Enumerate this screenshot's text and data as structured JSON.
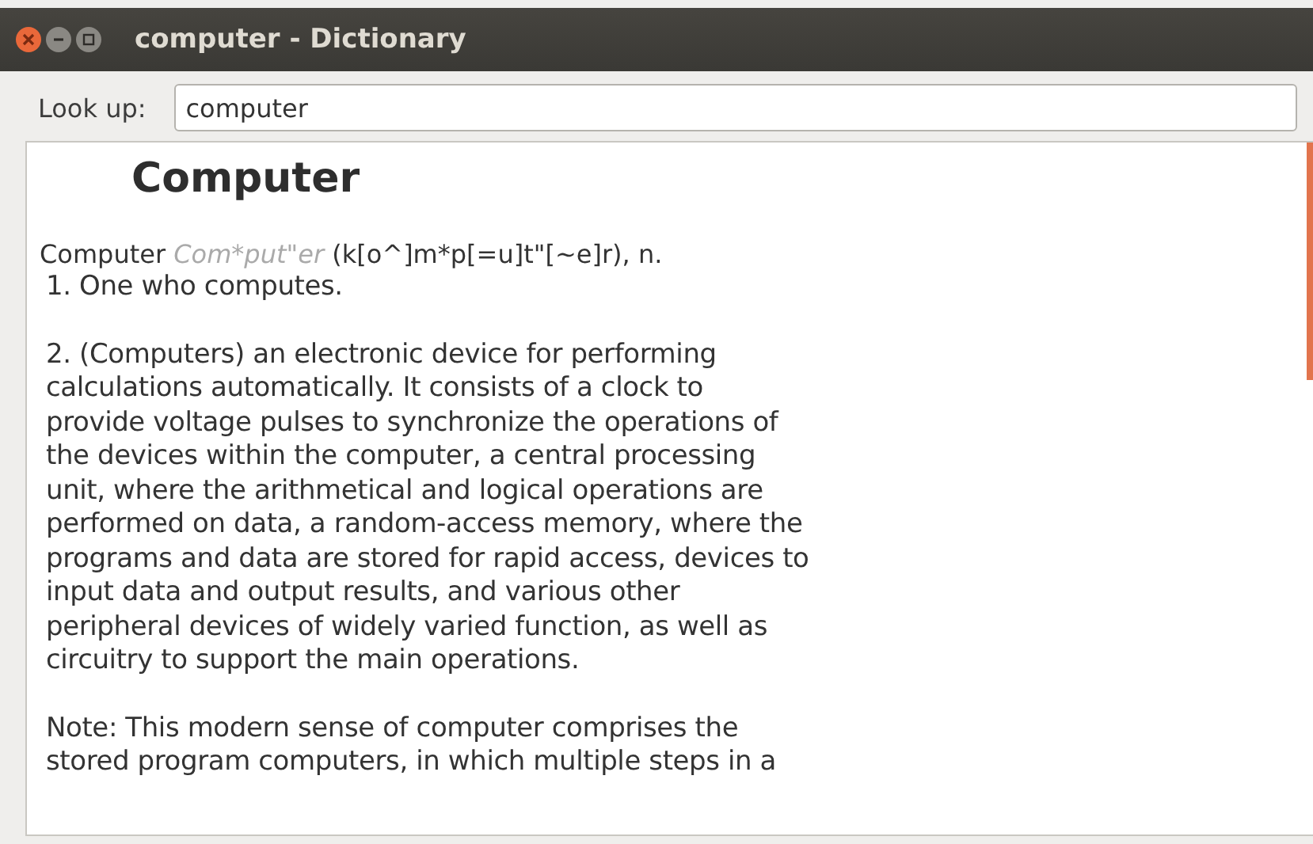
{
  "window": {
    "title": "computer - Dictionary"
  },
  "lookup": {
    "label": "Look up:",
    "value": "computer"
  },
  "entry": {
    "heading": "Computer",
    "pronunciation": {
      "word": "Computer",
      "syllables": "Com*put\"er",
      "rest": "(k[o^]m*p[=u]t\"[~e]r), n."
    },
    "paragraphs": [
      {
        "lines": [
          "1. One who computes."
        ]
      },
      {
        "lines": [
          "2. (Computers) an electronic device for performing",
          "calculations automatically. It consists of a clock to",
          "provide voltage pulses to synchronize the operations of",
          "the devices within the computer, a central processing",
          "unit, where the arithmetical and logical operations are",
          "performed on data, a random-access memory, where the",
          "programs and data are stored for rapid access, devices to",
          "input data and output results, and various other",
          "peripheral devices of widely varied function, as well as",
          "circuitry to support the main operations."
        ]
      },
      {
        "lines": [
          "Note: This modern sense of computer comprises the",
          "stored program computers, in which multiple steps in a"
        ]
      }
    ]
  }
}
